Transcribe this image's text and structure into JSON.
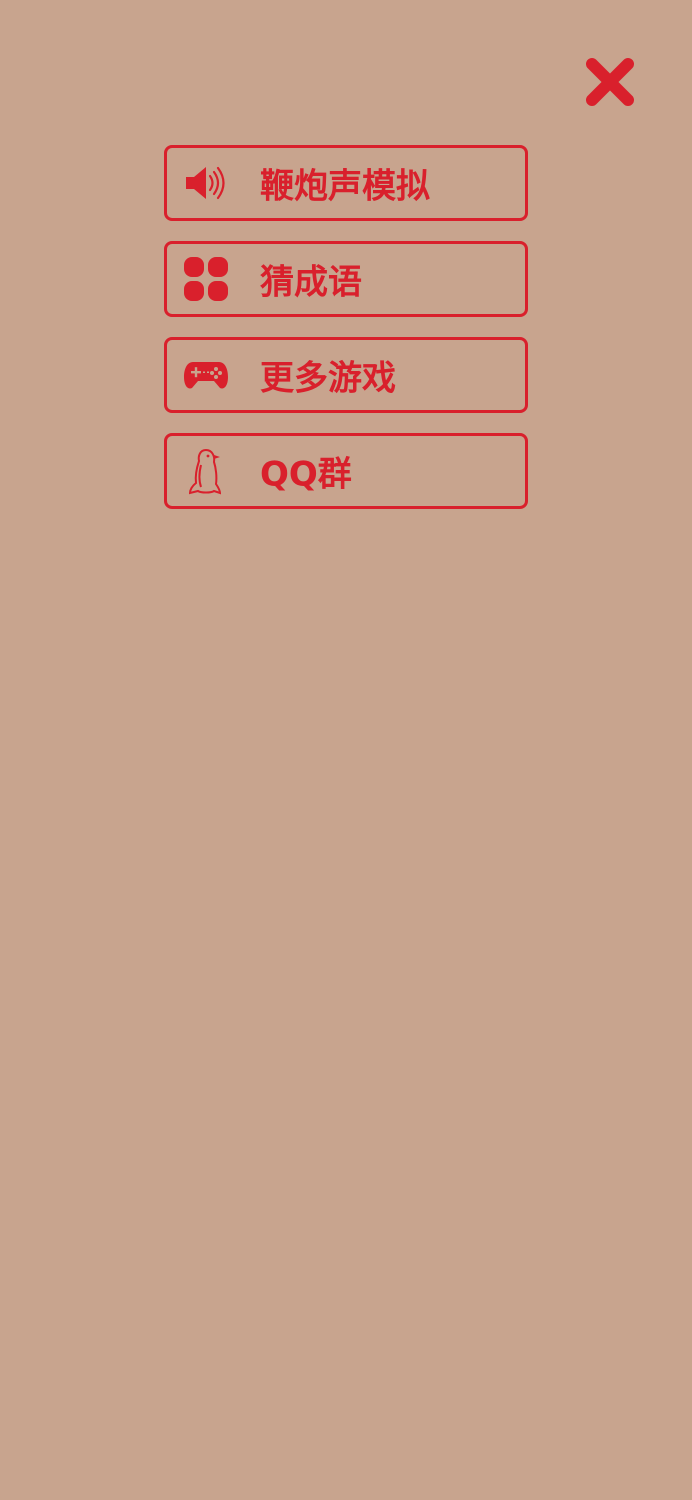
{
  "close_button": {
    "icon": "close-icon",
    "color": "#d9202c"
  },
  "menu": {
    "items": [
      {
        "label": "鞭炮声模拟",
        "icon": "speaker-icon"
      },
      {
        "label": "猜成语",
        "icon": "grid-dots-icon"
      },
      {
        "label": "更多游戏",
        "icon": "gamepad-icon"
      },
      {
        "label": "QQ群",
        "icon": "penguin-icon"
      }
    ]
  },
  "colors": {
    "background": "#c8a48e",
    "accent": "#d9202c"
  }
}
